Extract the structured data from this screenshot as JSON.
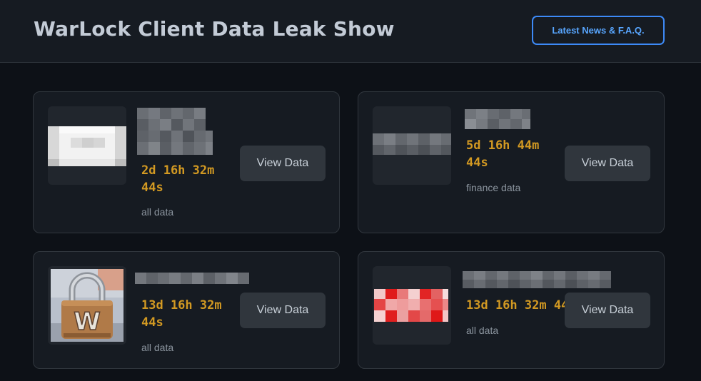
{
  "header": {
    "title": "WarLock Client Data Leak Show",
    "news_button": "Latest News & F.A.Q."
  },
  "cards": [
    {
      "timer": "2d 16h 32m\n44s",
      "category": "all data",
      "button": "View Data",
      "thumb_icon": "redacted-image"
    },
    {
      "timer": "5d 16h 44m\n44s",
      "category": "finance data",
      "button": "View Data",
      "thumb_icon": "redacted-image"
    },
    {
      "timer": "13d 16h 32m\n44s",
      "category": "all data",
      "button": "View Data",
      "thumb_icon": "padlock-w-logo"
    },
    {
      "timer": "13d 16h 32m 44s",
      "category": "all data",
      "button": "View Data",
      "thumb_icon": "redacted-image"
    }
  ],
  "colors": {
    "accent": "#3d8af7",
    "timer": "#d29922",
    "background": "#0d1117",
    "card": "#161b22"
  }
}
